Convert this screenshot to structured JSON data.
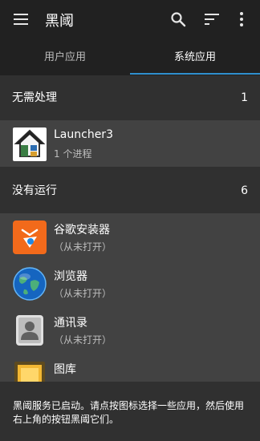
{
  "appbar": {
    "title": "黑阈",
    "menu_icon": "menu-icon",
    "search_icon": "search-icon",
    "sort_icon": "sort-icon",
    "more_icon": "more-vert-icon"
  },
  "tabs": [
    {
      "label": "用户应用",
      "selected": false
    },
    {
      "label": "系统应用",
      "selected": true
    }
  ],
  "accent_color": "#2f8fce",
  "sections": {
    "no_action": {
      "label": "无需处理",
      "count": "1"
    },
    "not_running": {
      "label": "没有运行",
      "count": "6"
    }
  },
  "apps": [
    {
      "name": "Launcher3",
      "status": "1 个进程",
      "icon": "launcher-house-icon"
    },
    {
      "name": "谷歌安装器",
      "status": "（从未打开）",
      "icon": "google-installer-icon"
    },
    {
      "name": "浏览器",
      "status": "（从未打开）",
      "icon": "browser-globe-icon"
    },
    {
      "name": "通讯录",
      "status": "（从未打开）",
      "icon": "contacts-icon"
    },
    {
      "name": "图库",
      "status": "",
      "icon": "gallery-icon"
    }
  ],
  "footer": {
    "message": "黑阈服务已启动。请点按图标选择一些应用，然后使用右上角的按钮黑阈它们。"
  }
}
